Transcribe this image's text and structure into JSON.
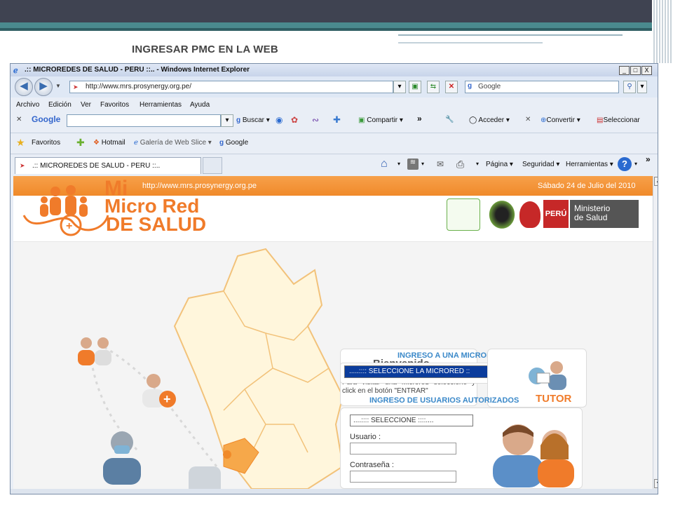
{
  "slide": {
    "title": "INGRESAR PMC EN LA WEB"
  },
  "browser": {
    "window_title": ".:: MICROREDES DE SALUD - PERU ::.. - Windows Internet Explorer",
    "window_controls": [
      "_",
      "□",
      "X"
    ],
    "address": "http://www.mrs.prosynergy.org.pe/",
    "search_placeholder": "Google",
    "menu": [
      "Archivo",
      "Edición",
      "Ver",
      "Favoritos",
      "Herramientas",
      "Ayuda"
    ],
    "google_bar": {
      "logo": "Google",
      "buscar": "Buscar",
      "compartir": "Compartir",
      "acceder": "Acceder",
      "convertir": "Convertir",
      "seleccionar": "Seleccionar"
    },
    "favorites": {
      "label": "Favoritos",
      "hotmail": "Hotmail",
      "galeria": "Galería de Web Slice",
      "google": "Google"
    },
    "tab": {
      "title": ".:: MICROREDES DE SALUD - PERU ::.."
    },
    "command_bar": {
      "pagina": "Página",
      "seguridad": "Seguridad",
      "herramientas": "Herramientas"
    }
  },
  "site": {
    "url_banner": "http://www.mrs.prosynergy.org.pe",
    "date": "Sábado 24 de Julio del 2010",
    "logo": {
      "line1": "Mi",
      "line2": "Micro Red",
      "line3": "DE SALUD"
    },
    "peru": "PERÚ",
    "ministerio": "Ministerio\nde Salud",
    "ingreso_microred": {
      "heading": "INGRESO A UNA MICRORED",
      "bienvenido": "Bienvenido",
      "select": ".....:::: SELECCIONE LA MICRORED ::",
      "instructions": "Para visitar una Microred seleccione y click en el botón \"ENTRAR\""
    },
    "tutor": "TUTOR",
    "ingreso_usuarios": {
      "heading": "INGRESO DE USUARIOS AUTORIZADOS",
      "select": "....:::: SELECCIONE ::::....",
      "usuario_label": "Usuario :",
      "contrasena_label": "Contraseña :"
    }
  },
  "colors": {
    "orange": "#f08a2a",
    "blue_heading": "#3b89c9",
    "slide_bar": "#3f4351",
    "teal": "#4a8a8e"
  }
}
